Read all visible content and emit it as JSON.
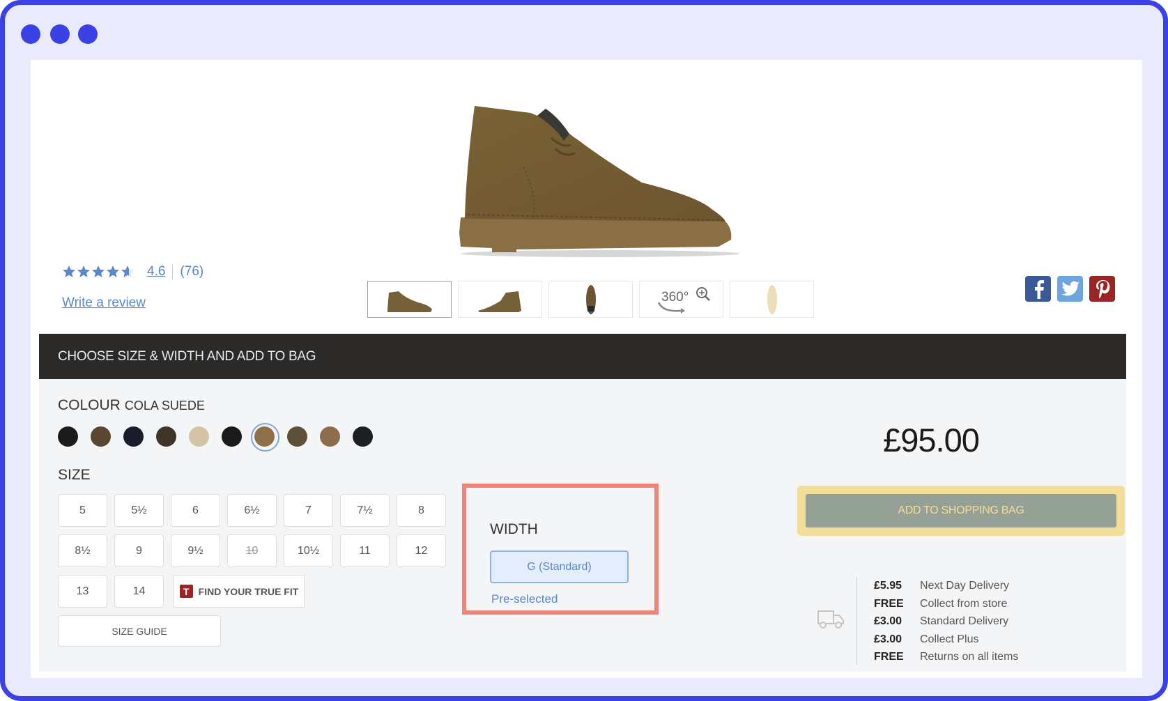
{
  "window": {
    "controls": [
      "dot",
      "dot",
      "dot"
    ],
    "accent_color": "#3a42e6"
  },
  "product": {
    "image_alt": "Desert boot in cola suede, side view",
    "rating": {
      "stars": 4.6,
      "max_stars": 5,
      "value_label": "4.6",
      "count_label": "(76)",
      "write_review_label": "Write a review"
    },
    "thumbnails": [
      {
        "name": "side-view",
        "active": true
      },
      {
        "name": "angle-view",
        "active": false
      },
      {
        "name": "top-view",
        "active": false
      },
      {
        "name": "360-view",
        "label": "360°",
        "active": false
      },
      {
        "name": "sole-view",
        "active": false
      }
    ],
    "social": [
      {
        "name": "facebook",
        "glyph": "f",
        "color": "#3b5998"
      },
      {
        "name": "twitter",
        "glyph": "t",
        "color": "#6ea4df"
      },
      {
        "name": "pinterest",
        "glyph": "P",
        "color": "#9b2424"
      }
    ]
  },
  "bar": {
    "title": "CHOOSE SIZE & WIDTH AND ADD TO BAG"
  },
  "colour": {
    "label": "COLOUR",
    "selected_name": "COLA SUEDE",
    "swatches": [
      {
        "color": "#1c1b1b",
        "selected": false
      },
      {
        "color": "#5a4631",
        "selected": false
      },
      {
        "color": "#1b1c2a",
        "selected": false
      },
      {
        "color": "#3e3428",
        "selected": false
      },
      {
        "color": "#d4c4a5",
        "selected": false
      },
      {
        "color": "#1a1a1a",
        "selected": false
      },
      {
        "color": "#8f7048",
        "selected": true
      },
      {
        "color": "#5d5038",
        "selected": false
      },
      {
        "color": "#8c6e4a",
        "selected": false
      },
      {
        "color": "#1e1f22",
        "selected": false
      }
    ]
  },
  "size": {
    "label": "SIZE",
    "options": [
      {
        "label": "5",
        "available": true
      },
      {
        "label": "5½",
        "available": true
      },
      {
        "label": "6",
        "available": true
      },
      {
        "label": "6½",
        "available": true
      },
      {
        "label": "7",
        "available": true
      },
      {
        "label": "7½",
        "available": true
      },
      {
        "label": "8",
        "available": true
      },
      {
        "label": "8½",
        "available": true
      },
      {
        "label": "9",
        "available": true
      },
      {
        "label": "9½",
        "available": true
      },
      {
        "label": "10",
        "available": false
      },
      {
        "label": "10½",
        "available": true
      },
      {
        "label": "11",
        "available": true
      },
      {
        "label": "12",
        "available": true
      },
      {
        "label": "13",
        "available": true
      },
      {
        "label": "14",
        "available": true
      }
    ],
    "true_fit_icon": "T",
    "true_fit_label": "FIND YOUR TRUE FIT",
    "size_guide_label": "SIZE GUIDE"
  },
  "width": {
    "label": "WIDTH",
    "selected": "G (Standard)",
    "note": "Pre-selected",
    "highlight_color": "#ee8577"
  },
  "purchase": {
    "price": "£95.00",
    "add_to_bag_label": "ADD TO SHOPPING BAG"
  },
  "delivery": {
    "icon": "truck-icon",
    "options": [
      {
        "price": "£5.95",
        "label": "Next Day Delivery"
      },
      {
        "price": "FREE",
        "label": "Collect from store"
      },
      {
        "price": "£3.00",
        "label": "Standard Delivery"
      },
      {
        "price": "£3.00",
        "label": "Collect Plus"
      },
      {
        "price": "FREE",
        "label": "Returns on all items"
      }
    ]
  }
}
